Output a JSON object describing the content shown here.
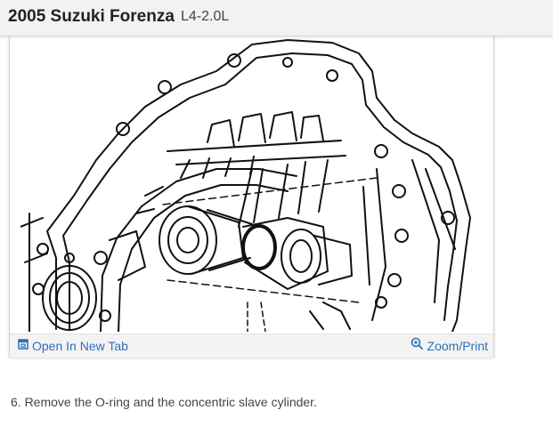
{
  "header": {
    "vehicle": "2005 Suzuki Forenza",
    "engine": "L4-2.0L"
  },
  "figure": {
    "open_tab_label": "Open In New Tab",
    "zoom_label": "Zoom/Print",
    "open_tab_icon": "external-window-icon",
    "zoom_icon": "magnifier-plus-icon",
    "link_color": "#2d6fb7"
  },
  "instructions": {
    "step": "6. Remove the O-ring and the concentric slave cylinder."
  }
}
